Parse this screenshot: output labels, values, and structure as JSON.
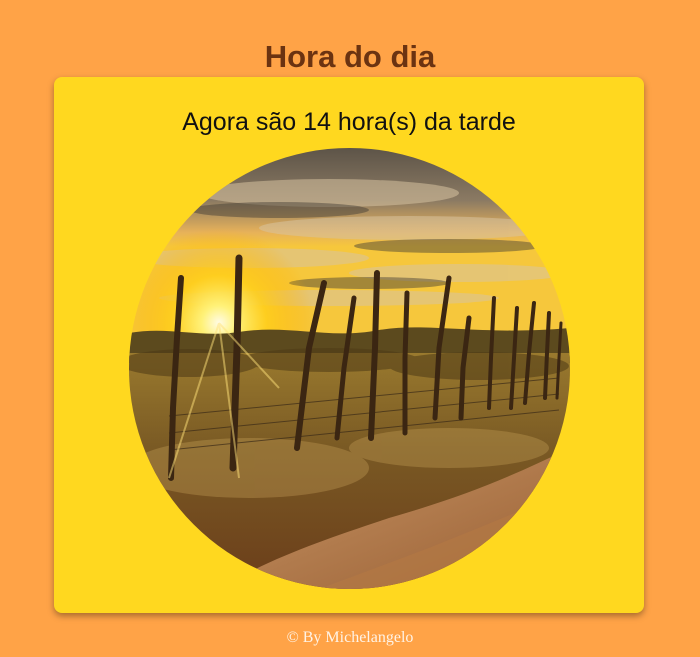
{
  "header": {
    "title": "Hora do dia"
  },
  "card": {
    "message": "Agora são 14 hora(s) da tarde",
    "image": {
      "alt": "Sunset over a rural fence line with a dirt road",
      "name": "sunset-landscape-image"
    }
  },
  "footer": {
    "text": "© By Michelangelo"
  },
  "colors": {
    "background": "#FFA347",
    "card": "#FFD81F",
    "title": "#6B3311",
    "footer_text": "#FFF3E6"
  }
}
